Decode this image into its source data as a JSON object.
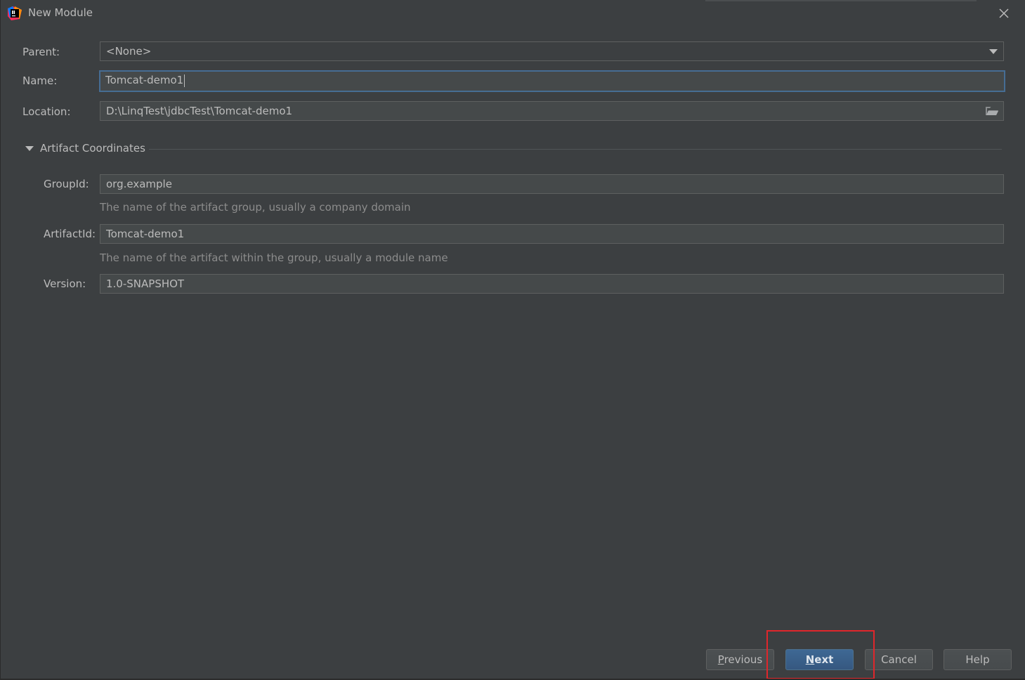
{
  "window": {
    "title": "New Module",
    "app_icon": "intellij-idea-icon",
    "close_icon": "close-icon"
  },
  "form": {
    "parent": {
      "label": "Parent:",
      "value": "<None>"
    },
    "name": {
      "label": "Name:",
      "value": "Tomcat-demo1"
    },
    "location": {
      "label": "Location:",
      "value": "D:\\LinqTest\\jdbcTest\\Tomcat-demo1"
    }
  },
  "artifact_section": {
    "title": "Artifact Coordinates",
    "expanded": true,
    "group_id": {
      "label": "GroupId:",
      "value": "org.example",
      "hint": "The name of the artifact group, usually a company domain"
    },
    "artifact_id": {
      "label": "ArtifactId:",
      "value": "Tomcat-demo1",
      "hint": "The name of the artifact within the group, usually a module name"
    },
    "version": {
      "label": "Version:",
      "value": "1.0-SNAPSHOT"
    }
  },
  "buttons": {
    "previous": {
      "mnemonic": "P",
      "rest": "revious"
    },
    "next": {
      "mnemonic": "N",
      "rest": "ext"
    },
    "cancel": "Cancel",
    "help": "Help"
  },
  "colors": {
    "background": "#3c3f41",
    "field_bg": "#45494a",
    "focus_border": "#466d94",
    "default_button": "#365880",
    "annotation_highlight": "#e0262b"
  }
}
